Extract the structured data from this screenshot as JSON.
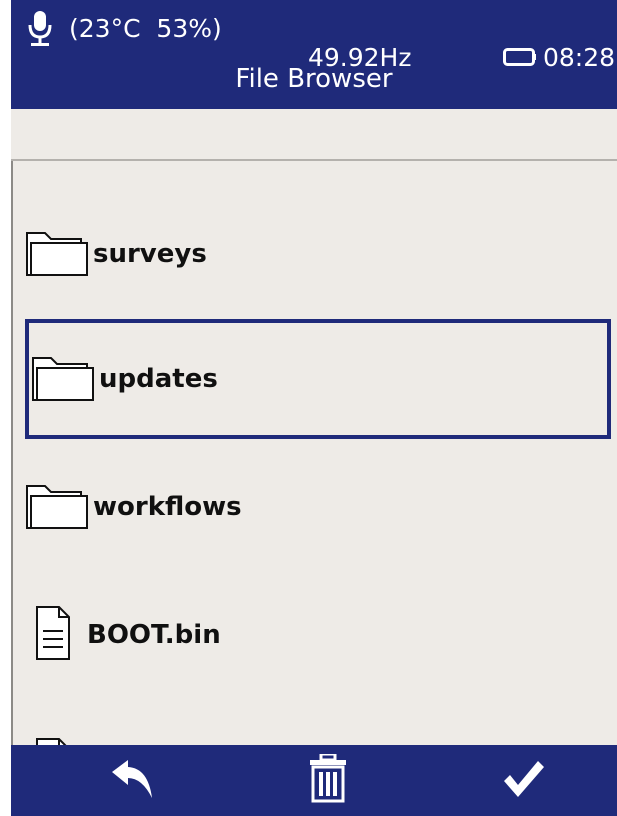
{
  "status": {
    "temp_humidity": "(23°C  53%)",
    "frequency": "49.92Hz",
    "time": "08:28"
  },
  "header": {
    "title": "File Browser"
  },
  "path_bar": {
    "text": ""
  },
  "files": [
    {
      "name": "surveys",
      "type": "folder",
      "icon": "folder-icon"
    },
    {
      "name": "updates",
      "type": "folder",
      "icon": "folder-icon",
      "selected": true
    },
    {
      "name": "workflows",
      "type": "folder",
      "icon": "folder-icon"
    },
    {
      "name": "BOOT.bin",
      "type": "file",
      "icon": "file-icon"
    }
  ],
  "toolbar": {
    "back": "back-arrow-icon",
    "delete": "trash-icon",
    "confirm": "checkmark-icon"
  },
  "colors": {
    "header": "#1f2a7a",
    "background": "#eeebe7",
    "selection": "#1f2a7a"
  }
}
